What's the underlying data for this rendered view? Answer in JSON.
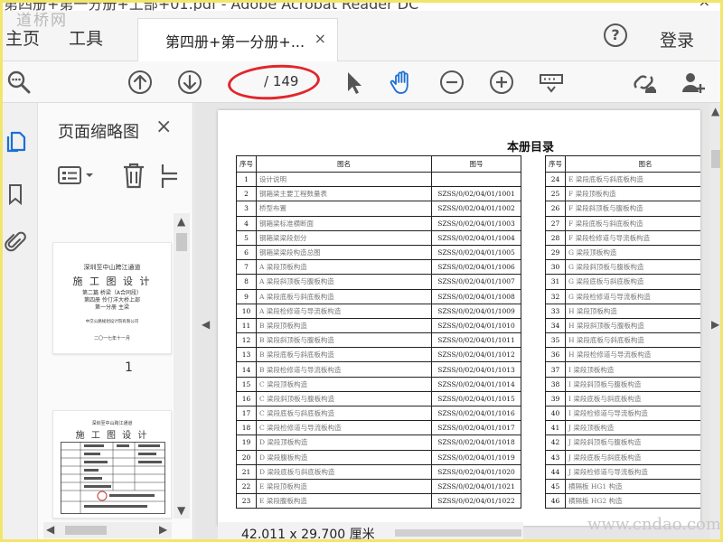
{
  "window": {
    "title": "第四册+第一分册+上部+01.pdf - Adobe Acrobat Reader DC",
    "close": "×"
  },
  "watermark_top": "道桥网",
  "watermark_bottom": "www.cndao.com",
  "tabs": {
    "home": "主页",
    "tools": "工具",
    "document": "第四册+第一分册+...",
    "close": "×"
  },
  "header": {
    "help": "?",
    "login": "登录"
  },
  "toolbar": {
    "current_page": "",
    "total_pages": "/ 149",
    "accent": "#e1262b",
    "icon_color": "#555555",
    "hand_color": "#1a6fd6"
  },
  "thumbnails": {
    "title": "页面缩略图",
    "close": "×",
    "page_label": "1",
    "thumb1": {
      "line1": "深圳至中山跨江通道",
      "line2": "施 工 图 设 计",
      "line3": "第二篇 桥梁（A合同段）",
      "line4": "第四册 伶仃洋大桥上部",
      "line5": "第一分册 主梁",
      "line6": "中交公路规划设计院有限公司",
      "line7": "二〇一七年十一月"
    },
    "thumb2": {
      "line1": "深圳至中山跨江通道",
      "line2": "施 工 图 设 计"
    }
  },
  "document": {
    "title": "本册目录",
    "headers": {
      "no": "序号",
      "name": "图名",
      "code": "图号"
    },
    "left_rows": [
      {
        "no": "1",
        "name": "设计说明",
        "code": ""
      },
      {
        "no": "2",
        "name": "钢箱梁主要工程数量表",
        "code": "SZSS/0/02/04/01/1001"
      },
      {
        "no": "3",
        "name": "桥型布置",
        "code": "SZSS/0/02/04/01/1002"
      },
      {
        "no": "4",
        "name": "钢箱梁标准横断面",
        "code": "SZSS/0/02/04/01/1003"
      },
      {
        "no": "5",
        "name": "钢箱梁梁段划分",
        "code": "SZSS/0/02/04/01/1004"
      },
      {
        "no": "6",
        "name": "钢箱梁梁段构造总图",
        "code": "SZSS/0/02/04/01/1005"
      },
      {
        "no": "7",
        "name": "A 梁段顶板构造",
        "code": "SZSS/0/02/04/01/1006"
      },
      {
        "no": "8",
        "name": "A 梁段斜顶板与腹板构造",
        "code": "SZSS/0/02/04/01/1007"
      },
      {
        "no": "9",
        "name": "A 梁段底板与斜底板构造",
        "code": "SZSS/0/02/04/01/1008"
      },
      {
        "no": "10",
        "name": "A 梁段检修道与导流板构造",
        "code": "SZSS/0/02/04/01/1009"
      },
      {
        "no": "11",
        "name": "B 梁段顶板构造",
        "code": "SZSS/0/02/04/01/1010"
      },
      {
        "no": "12",
        "name": "B 梁段斜顶板与腹板构造",
        "code": "SZSS/0/02/04/01/1011"
      },
      {
        "no": "13",
        "name": "B 梁段底板与斜底板构造",
        "code": "SZSS/0/02/04/01/1012"
      },
      {
        "no": "14",
        "name": "B 梁段检修道与导流板构造",
        "code": "SZSS/0/02/04/01/1013"
      },
      {
        "no": "15",
        "name": "C 梁段顶板构造",
        "code": "SZSS/0/02/04/01/1014"
      },
      {
        "no": "16",
        "name": "C 梁段斜顶板与腹板构造",
        "code": "SZSS/0/02/04/01/1015"
      },
      {
        "no": "17",
        "name": "C 梁段底板与斜底板构造",
        "code": "SZSS/0/02/04/01/1016"
      },
      {
        "no": "18",
        "name": "C 梁段检修道与导流板构造",
        "code": "SZSS/0/02/04/01/1017"
      },
      {
        "no": "19",
        "name": "D 梁段顶板构造",
        "code": "SZSS/0/02/04/01/1018"
      },
      {
        "no": "20",
        "name": "D 梁段腹板构造",
        "code": "SZSS/0/02/04/01/1019"
      },
      {
        "no": "21",
        "name": "D 梁段底板与斜底板构造",
        "code": "SZSS/0/02/04/01/1020"
      },
      {
        "no": "22",
        "name": "E 梁段顶板构造",
        "code": "SZSS/0/02/04/01/1021"
      },
      {
        "no": "23",
        "name": "E 梁段腹板构造",
        "code": "SZSS/0/02/04/01/1022"
      }
    ],
    "right_rows": [
      {
        "no": "24",
        "name": "E 梁段底板与斜底板构造"
      },
      {
        "no": "25",
        "name": "F 梁段顶板构造"
      },
      {
        "no": "26",
        "name": "F 梁段斜顶板与腹板构造"
      },
      {
        "no": "27",
        "name": "F 梁段底板与斜底板构造"
      },
      {
        "no": "28",
        "name": "F 梁段检修道与导流板构造"
      },
      {
        "no": "29",
        "name": "G 梁段顶板构造"
      },
      {
        "no": "30",
        "name": "G 梁段斜顶板与腹板构造"
      },
      {
        "no": "31",
        "name": "G 梁段底板与斜底板构造"
      },
      {
        "no": "32",
        "name": "G 梁段检修道与导流板构造"
      },
      {
        "no": "33",
        "name": "H 梁段顶板构造"
      },
      {
        "no": "34",
        "name": "H 梁段斜顶板与腹板构造"
      },
      {
        "no": "35",
        "name": "H 梁段底板与斜底板构造"
      },
      {
        "no": "36",
        "name": "H 梁段检修道与导流板构造"
      },
      {
        "no": "37",
        "name": "I 梁段顶板构造"
      },
      {
        "no": "38",
        "name": "I 梁段斜顶板与腹板构造"
      },
      {
        "no": "39",
        "name": "I 梁段底板与斜底板构造"
      },
      {
        "no": "40",
        "name": "I 梁段检修道与导流板构造"
      },
      {
        "no": "41",
        "name": "J 梁段顶板构造"
      },
      {
        "no": "42",
        "name": "J 梁段斜顶板与腹板构造"
      },
      {
        "no": "43",
        "name": "J 梁段底板与斜底板构造"
      },
      {
        "no": "44",
        "name": "J 梁段检修道与导流板构造"
      },
      {
        "no": "45",
        "name": "横隔板 HG1 构造"
      },
      {
        "no": "46",
        "name": "横隔板 HG2 构造"
      }
    ]
  },
  "status": {
    "page_size": "42.011 x 29.700 厘米"
  }
}
